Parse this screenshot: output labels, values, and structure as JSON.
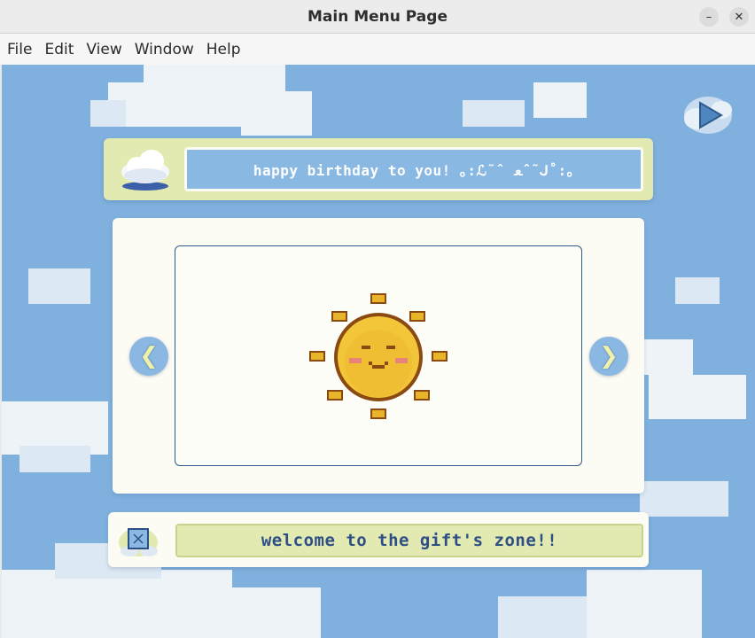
{
  "window": {
    "title": "Main Menu Page",
    "minimize_glyph": "–",
    "close_glyph": "✕"
  },
  "menubar": {
    "items": [
      "File",
      "Edit",
      "View",
      "Window",
      "Help"
    ]
  },
  "header": {
    "text": "happy birthday to you! ｡:ℒ˜ˆ ﻌˆ˜ᒍ˚:｡",
    "icon": "cloud-icon"
  },
  "gallery": {
    "prev_glyph": "❮",
    "next_glyph": "❯",
    "image": "smiling-sun-image"
  },
  "play_button": {
    "icon": "play-icon"
  },
  "footer": {
    "text": "welcome to the gift's zone!!",
    "icon": "gift-box-icon"
  },
  "colors": {
    "sky": "#7fb0de",
    "panel_yellow": "#e3eab1",
    "panel_cream": "#fcfbf4",
    "header_blue": "#89b8e3",
    "footer_text": "#2e4f86",
    "frame_border": "#2f5b8a"
  }
}
